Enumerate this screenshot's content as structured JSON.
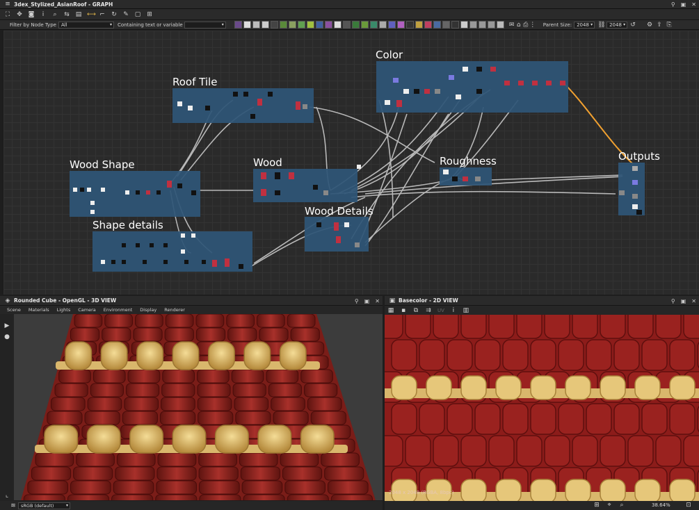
{
  "window": {
    "title": "3dex_Stylized_AsianRoof - GRAPH"
  },
  "filter": {
    "node_type_label": "Filter by Node Type",
    "node_type_value": "All",
    "containing_label": "Containing text or variable",
    "containing_value": ""
  },
  "toolbar": {
    "parent_size_label": "Parent Size:",
    "parent_size_value": "2048",
    "output_size_value": "2048"
  },
  "graph": {
    "frames": [
      "Color",
      "Roof Tile",
      "Wood Shape",
      "Wood",
      "Roughness",
      "Outputs",
      "Wood Details",
      "Shape details"
    ],
    "accent_frame": "#2e5576",
    "accent_link": "#f0a030"
  },
  "view3d": {
    "title": "Rounded Cube - OpenGL - 3D VIEW",
    "menu": [
      "Scene",
      "Materials",
      "Lights",
      "Camera",
      "Environment",
      "Display",
      "Renderer"
    ],
    "colorspace": "sRGB (default)"
  },
  "view2d": {
    "title": "Basecolor - 2D VIEW",
    "uv_label": "UV",
    "info_text": "2048 x 2048 (RGBA, 8bpc)",
    "zoom": "38.64%"
  },
  "colors": {
    "tile_red": "#8c1c1a",
    "tile_red_dark": "#5e0f0e",
    "ornament_gold": "#e6c77a"
  }
}
